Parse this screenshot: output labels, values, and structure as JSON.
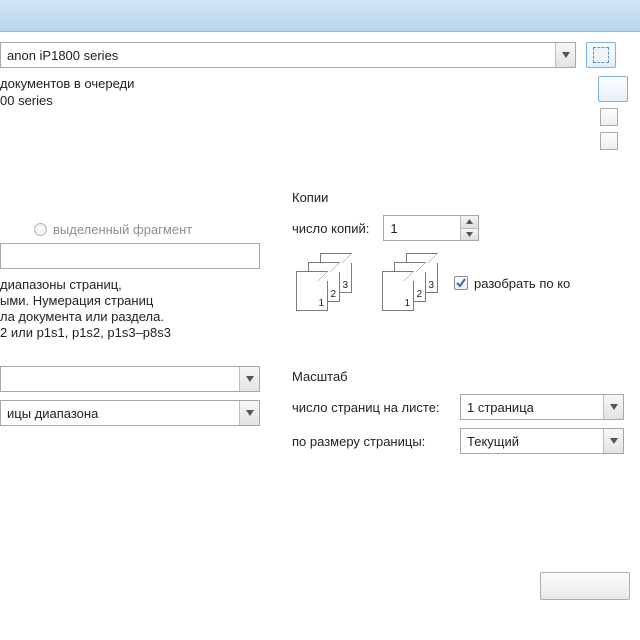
{
  "printer": {
    "selected": "anon iP1800 series",
    "status": "документов в очереди",
    "type_line": "00 series"
  },
  "range": {
    "selection_label": "выделенный фрагмент",
    "help1": "диапазоны страниц,",
    "help2": "ыми. Нумерация страниц",
    "help3": "ла документа или раздела.",
    "help4": "2 или p1s1, p1s2, p1s3–p8s3",
    "include_label": "ицы диапазона"
  },
  "copies": {
    "title": "Копии",
    "count_label": "число копий:",
    "count_value": "1",
    "collate_label": "разобрать по ко",
    "collate_checked": true,
    "stack_labels": [
      "1",
      "2",
      "3"
    ]
  },
  "scale": {
    "title": "Масштаб",
    "pages_label": "число страниц на листе:",
    "pages_value": "1 страница",
    "fit_label": "по размеру страницы:",
    "fit_value": "Текущий"
  }
}
